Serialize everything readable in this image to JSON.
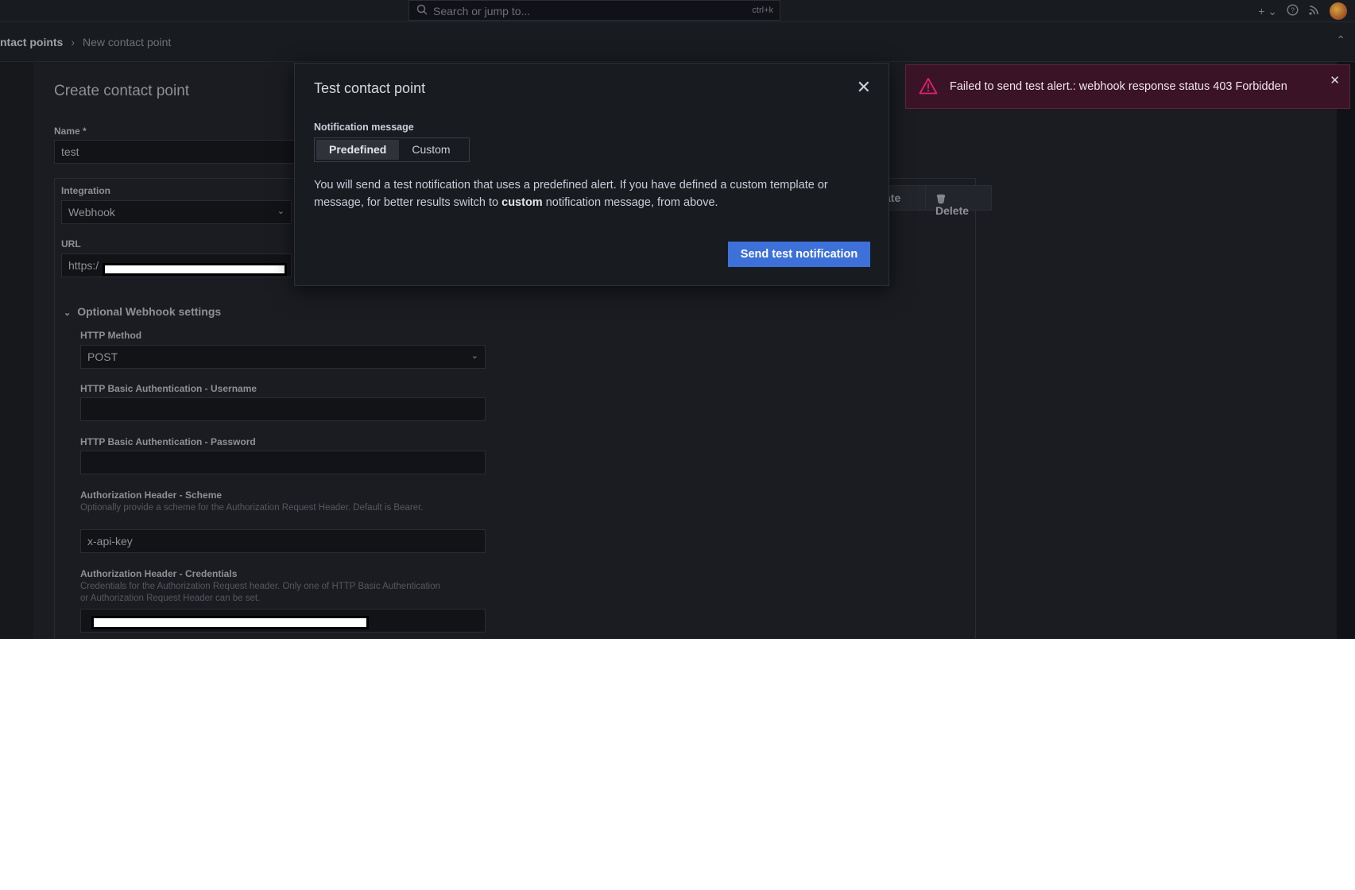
{
  "topbar": {
    "search_placeholder": "Search or jump to...",
    "shortcut": "ctrl+k",
    "icons": [
      "plus-icon",
      "chevron-down-icon",
      "help-icon",
      "rss-icon",
      "avatar"
    ]
  },
  "breadcrumb": {
    "parent": "ntact points",
    "separator": "›",
    "current": "New contact point"
  },
  "form": {
    "title": "Create contact point",
    "name_label": "Name *",
    "name_value": "test",
    "integration_label": "Integration",
    "integration_value": "Webhook",
    "url_label": "URL",
    "url_value": "https:/",
    "optional_settings": "Optional Webhook settings",
    "http_method_label": "HTTP Method",
    "http_method_value": "POST",
    "basic_user_label": "HTTP Basic Authentication - Username",
    "basic_pass_label": "HTTP Basic Authentication - Password",
    "auth_scheme_label": "Authorization Header - Scheme",
    "auth_scheme_hint": "Optionally provide a scheme for the Authorization Request Header. Default is Bearer.",
    "auth_scheme_value": "x-api-key",
    "auth_cred_label": "Authorization Header - Credentials",
    "auth_cred_hint": "Credentials for the Authorization Request header. Only one of HTTP Basic Authentication or Authorization Request Header can be set.",
    "duplicate_label": "ate",
    "delete_label": "Delete"
  },
  "modal": {
    "title": "Test contact point",
    "message_label": "Notification message",
    "options": [
      "Predefined",
      "Custom"
    ],
    "selected": "Predefined",
    "text_before": "You will send a test notification that uses a predefined alert. If you have defined a custom template or message, for better results switch to ",
    "text_bold": "custom",
    "text_after": " notification message, from above.",
    "send_label": "Send test notification"
  },
  "toast": {
    "message": "Failed to send test alert.: webhook response status 403 Forbidden",
    "accent": "#e0226e"
  },
  "colors": {
    "primary": "#3d71d9",
    "background": "#111217",
    "error_bg": "#3a1426"
  }
}
